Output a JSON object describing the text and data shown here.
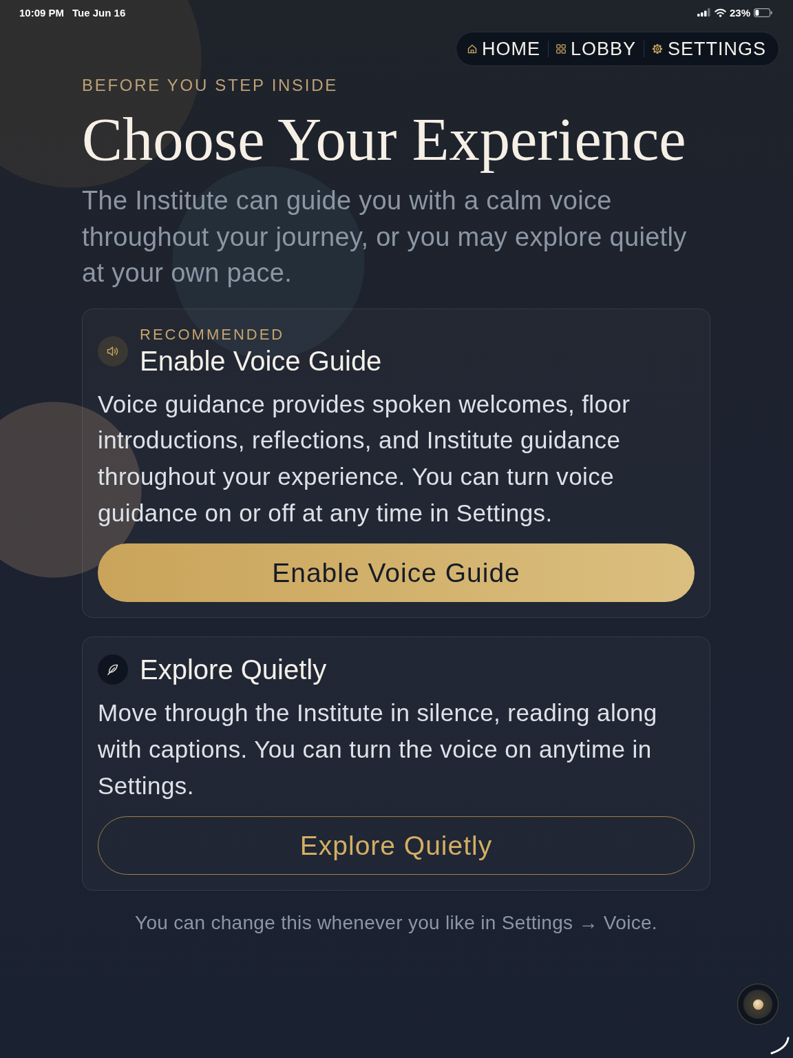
{
  "status_bar": {
    "time": "10:09 PM",
    "date": "Tue Jun 16",
    "battery": "23%"
  },
  "nav": {
    "items": [
      {
        "kind": "home",
        "label": "HOME"
      },
      {
        "kind": "lobby",
        "label": "LOBBY"
      },
      {
        "kind": "settings",
        "label": "SETTINGS"
      }
    ]
  },
  "header": {
    "eyebrow": "BEFORE YOU STEP INSIDE",
    "title": "Choose Your Experience",
    "intro": "The Institute can guide you with a calm voice throughout your journey, or you may explore quietly at your own pace."
  },
  "options": [
    {
      "kind": "voice",
      "badge": "RECOMMENDED",
      "title": "Enable Voice Guide",
      "description": "Voice guidance provides spoken welcomes, floor introductions, reflections, and Institute guidance throughout your experience. You can turn voice guidance on or off at any time in Settings.",
      "button": "Enable Voice Guide"
    },
    {
      "kind": "quiet",
      "title": "Explore Quietly",
      "description": "Move through the Institute in silence, reading along with captions. You can turn the voice on anytime in Settings.",
      "button": "Explore Quietly"
    }
  ],
  "footnote": "You can change this whenever you like in Settings → Voice."
}
